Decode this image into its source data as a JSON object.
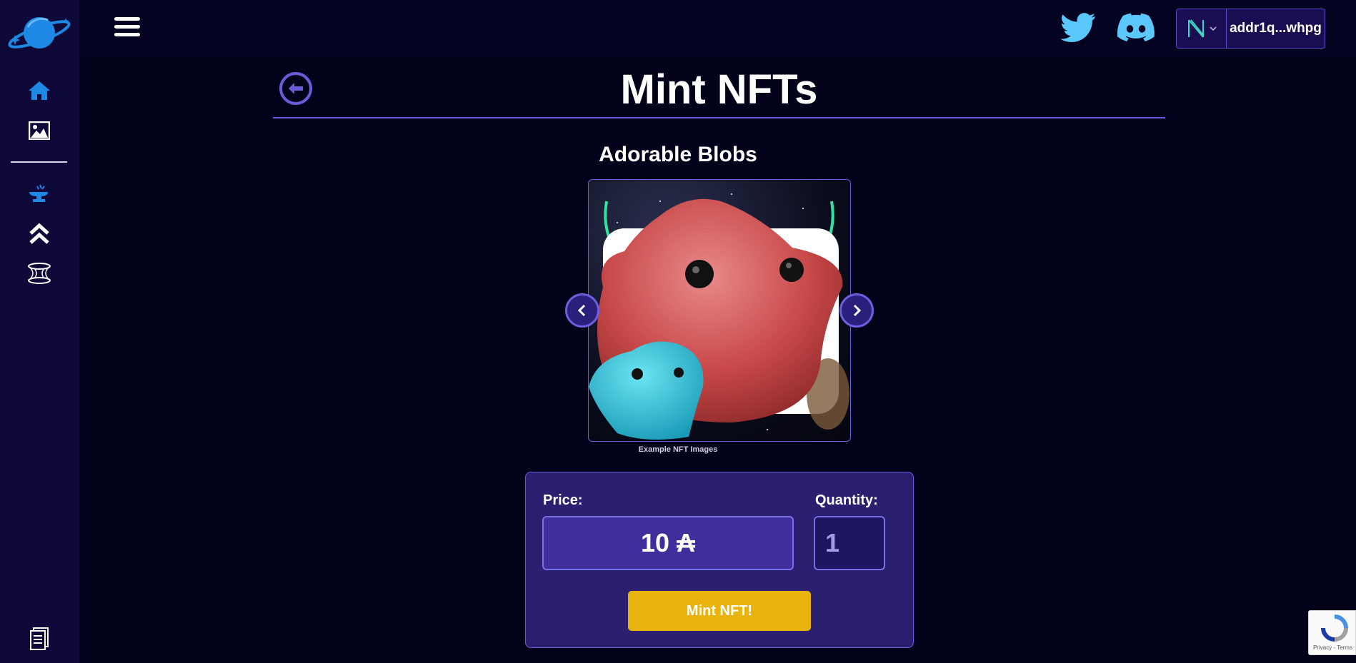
{
  "sidebar": {
    "items": [
      {
        "icon": "home-icon"
      },
      {
        "icon": "image-icon"
      },
      {
        "icon": "anvil-icon"
      },
      {
        "icon": "chevrons-up-icon"
      },
      {
        "icon": "wormhole-icon"
      }
    ],
    "bottom_icon": "document-icon",
    "accent": "#1e88e5"
  },
  "topbar": {
    "wallet_address": "addr1q...whpg"
  },
  "page": {
    "title": "Mint NFTs",
    "collection_title": "Adorable Blobs",
    "image_caption": "Example NFT Images"
  },
  "mint": {
    "price_label": "Price:",
    "price_value": "10 ₳",
    "quantity_label": "Quantity:",
    "quantity_value": "1",
    "button_label": "Mint NFT!"
  },
  "recaptcha": {
    "text": "Privacy - Terms"
  },
  "colors": {
    "background": "#02021a",
    "sidebar": "#0e0938",
    "card": "#2b2070",
    "accent_purple": "#6a5cd8",
    "button_yellow": "#e8b30e",
    "twitter_blue": "#5ac8fa"
  }
}
